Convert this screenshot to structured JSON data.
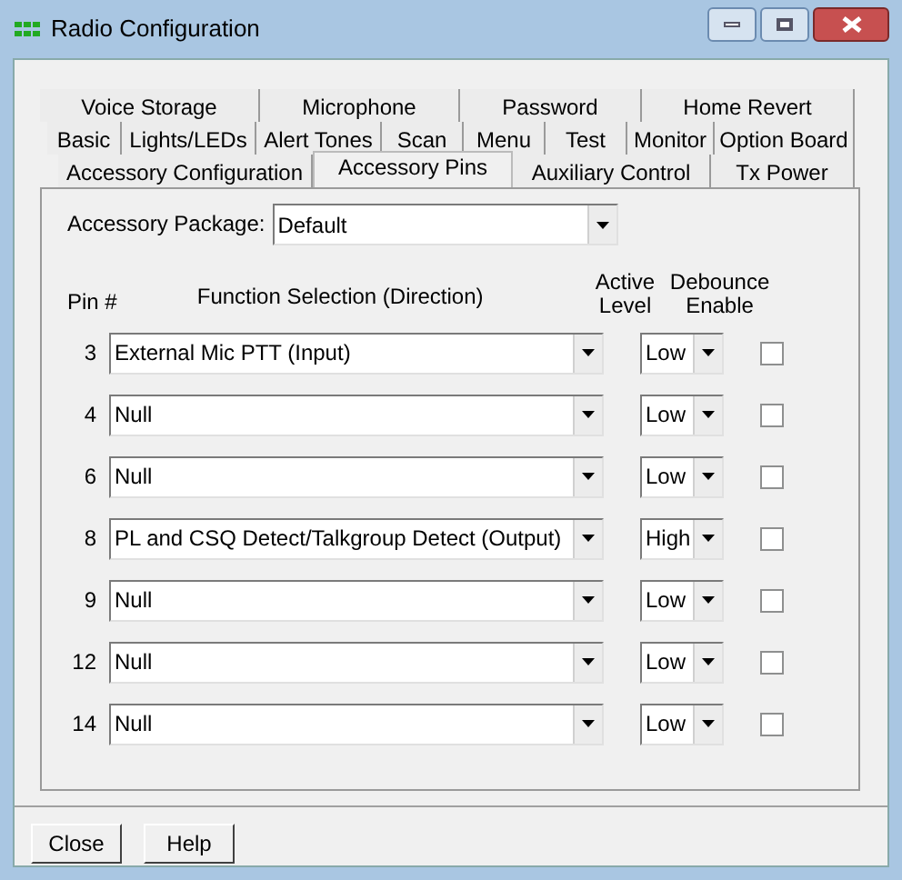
{
  "window": {
    "title": "Radio Configuration"
  },
  "tab_rows": [
    [
      {
        "label": "Voice Storage",
        "selected": false
      },
      {
        "label": "Microphone",
        "selected": false
      },
      {
        "label": "Password",
        "selected": false
      },
      {
        "label": "Home Revert",
        "selected": false
      }
    ],
    [
      {
        "label": "Basic",
        "selected": false
      },
      {
        "label": "Lights/LEDs",
        "selected": false
      },
      {
        "label": "Alert Tones",
        "selected": false
      },
      {
        "label": "Scan",
        "selected": false
      },
      {
        "label": "Menu",
        "selected": false
      },
      {
        "label": "Test",
        "selected": false
      },
      {
        "label": "Monitor",
        "selected": false
      },
      {
        "label": "Option Board",
        "selected": false
      }
    ],
    [
      {
        "label": "Accessory Configuration",
        "selected": false
      },
      {
        "label": "Accessory Pins",
        "selected": true
      },
      {
        "label": "Auxiliary Control",
        "selected": false
      },
      {
        "label": "Tx Power",
        "selected": false
      }
    ]
  ],
  "accessory_package": {
    "label": "Accessory Package:",
    "value": "Default"
  },
  "columns": {
    "pin": "Pin #",
    "function": "Function Selection (Direction)",
    "level": "Active Level",
    "debounce": "Debounce Enable"
  },
  "pins": [
    {
      "pin": "3",
      "function": "External Mic PTT (Input)",
      "level": "Low",
      "debounce": false
    },
    {
      "pin": "4",
      "function": "Null",
      "level": "Low",
      "debounce": false
    },
    {
      "pin": "6",
      "function": "Null",
      "level": "Low",
      "debounce": false
    },
    {
      "pin": "8",
      "function": "PL and CSQ Detect/Talkgroup Detect (Output)",
      "level": "High",
      "debounce": false
    },
    {
      "pin": "9",
      "function": "Null",
      "level": "Low",
      "debounce": false
    },
    {
      "pin": "12",
      "function": "Null",
      "level": "Low",
      "debounce": false
    },
    {
      "pin": "14",
      "function": "Null",
      "level": "Low",
      "debounce": false
    }
  ],
  "buttons": [
    "Close",
    "Help"
  ]
}
